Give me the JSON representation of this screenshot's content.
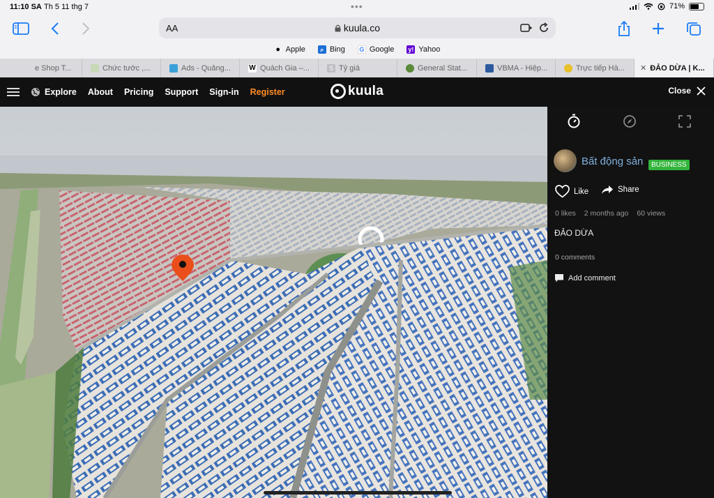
{
  "status": {
    "time": "11:10 SA",
    "date": "Th 5 11 thg 7",
    "battery": "71%",
    "battery_fraction": 0.71
  },
  "toolbar": {
    "text_size": "AA",
    "url": "kuula.co"
  },
  "favorites": [
    {
      "label": "Apple",
      "icon": "apple-icon",
      "color": "#000000"
    },
    {
      "label": "Bing",
      "icon": "bing-search-icon",
      "color": "#1d6fd6"
    },
    {
      "label": "Google",
      "icon": "google-icon",
      "color": "#4285f4"
    },
    {
      "label": "Yahoo",
      "icon": "yahoo-icon",
      "color": "#6001d2"
    }
  ],
  "tabs": [
    {
      "label": "e Shop T...",
      "color": "#d8d8dc"
    },
    {
      "label": "Chức tước ,...",
      "color": "#c8d9b8"
    },
    {
      "label": "Ads - Quảng...",
      "color": "#3aa0d8"
    },
    {
      "label": "Quách Gia –...",
      "color": "#ffffff"
    },
    {
      "label": "Tỷ giá",
      "color": "#bdbdc2"
    },
    {
      "label": "General Stat...",
      "color": "#5a8a3a"
    },
    {
      "label": "VBMA - Hiệp...",
      "color": "#2d5a9e"
    },
    {
      "label": "Trực tiếp Hà...",
      "color": "#e8c02a"
    },
    {
      "label": "ĐẢO DỪA | K...",
      "color": "#ffffff",
      "active": true
    }
  ],
  "kuula": {
    "nav": [
      "Explore",
      "About",
      "Pricing",
      "Support",
      "Sign-in"
    ],
    "register": "Register",
    "logo": "kuula",
    "close": "Close",
    "owner": "Bất động sản",
    "badge": "BUSINESS",
    "like": "Like",
    "share": "Share",
    "likes": "0 likes",
    "time_ago": "2 months ago",
    "views": "60 views",
    "post_title": "ĐẢO DỪA",
    "comments": "0 comments",
    "add_comment": "Add comment",
    "accent": "#ff8c26",
    "badge_color": "#33b53c"
  }
}
